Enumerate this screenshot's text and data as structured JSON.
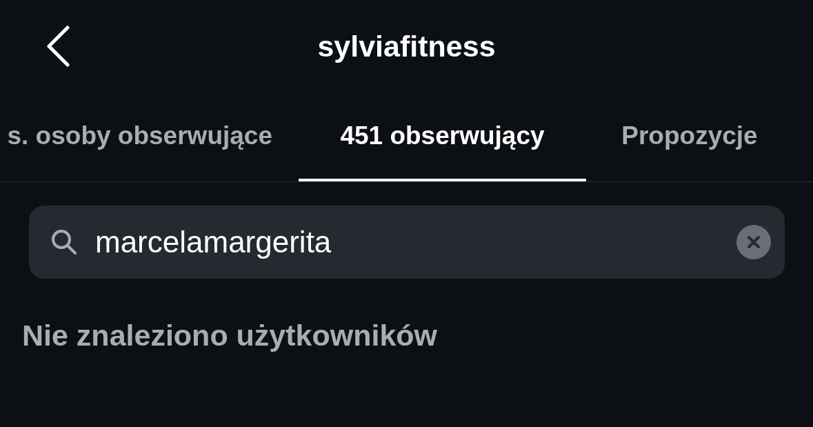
{
  "header": {
    "title": "sylviafitness"
  },
  "tabs": [
    {
      "label": "s. osoby obserwujące",
      "selected": false
    },
    {
      "label": "451 obserwujący",
      "selected": true
    },
    {
      "label": "Propozycje",
      "selected": false
    }
  ],
  "search": {
    "value": "marcelamargerita"
  },
  "empty_message": "Nie znaleziono użytkowników"
}
